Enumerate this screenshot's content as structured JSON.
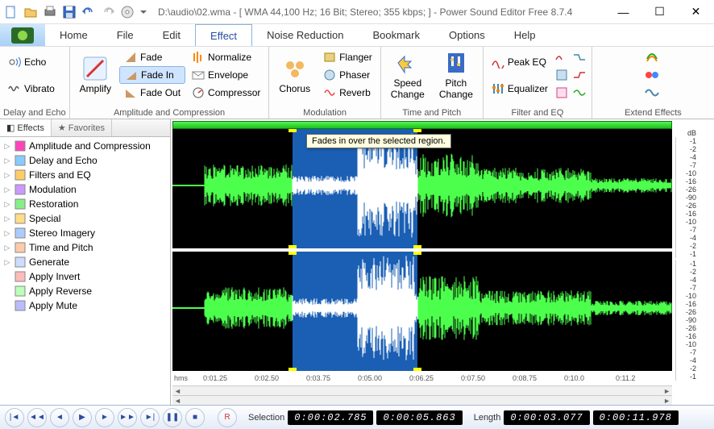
{
  "title": "D:\\audio\\02.wma - [ WMA 44,100 Hz; 16 Bit; Stereo; 355 kbps; ] - Power Sound Editor Free 8.7.4",
  "menus": [
    "Home",
    "File",
    "Edit",
    "Effect",
    "Noise Reduction",
    "Bookmark",
    "Options",
    "Help"
  ],
  "active_menu": "Effect",
  "ribbon": {
    "delay_echo": {
      "label": "Delay and Echo",
      "echo": "Echo",
      "vibrato": "Vibrato"
    },
    "amplify": {
      "label": "Amplify"
    },
    "amp_comp": {
      "label": "Amplitude and Compression",
      "fade": "Fade",
      "fade_in": "Fade In",
      "fade_out": "Fade Out",
      "normalize": "Normalize",
      "envelope": "Envelope",
      "compressor": "Compressor"
    },
    "modulation": {
      "label": "Modulation",
      "chorus": "Chorus",
      "flanger": "Flanger",
      "phaser": "Phaser",
      "reverb": "Reverb"
    },
    "time_pitch": {
      "label": "Time and Pitch",
      "speed": "Speed\nChange",
      "pitch": "Pitch\nChange"
    },
    "filter_eq": {
      "label": "Filter and EQ",
      "peakeq": "Peak EQ",
      "equalizer": "Equalizer"
    },
    "extend": {
      "label": "Extend Effects"
    }
  },
  "tooltip": "Fades in over the selected region.",
  "side_tabs": {
    "effects": "Effects",
    "favorites": "Favorites"
  },
  "tree": [
    "Amplitude and Compression",
    "Delay and Echo",
    "Filters and EQ",
    "Modulation",
    "Restoration",
    "Special",
    "Stereo Imagery",
    "Time and Pitch",
    "Generate",
    "Apply Invert",
    "Apply Reverse",
    "Apply Mute"
  ],
  "db_header": "dB",
  "db_scale": [
    "-1",
    "-2",
    "-4",
    "-7",
    "-10",
    "-16",
    "-26",
    "-90",
    "-26",
    "-16",
    "-10",
    "-7",
    "-4",
    "-2",
    "-1"
  ],
  "timeline": {
    "unit": "hms",
    "ticks": [
      "0:01.25",
      "0:02.50",
      "0:03.75",
      "0:05.00",
      "0:06.25",
      "0:07.50",
      "0:08.75",
      "0:10.0",
      "0:11.2"
    ]
  },
  "status": {
    "selection_label": "Selection",
    "selection_start": "0:00:02.785",
    "selection_end": "0:00:05.863",
    "length_label": "Length",
    "length": "0:00:03.077",
    "total": "0:00:11.978",
    "rec": "R"
  }
}
